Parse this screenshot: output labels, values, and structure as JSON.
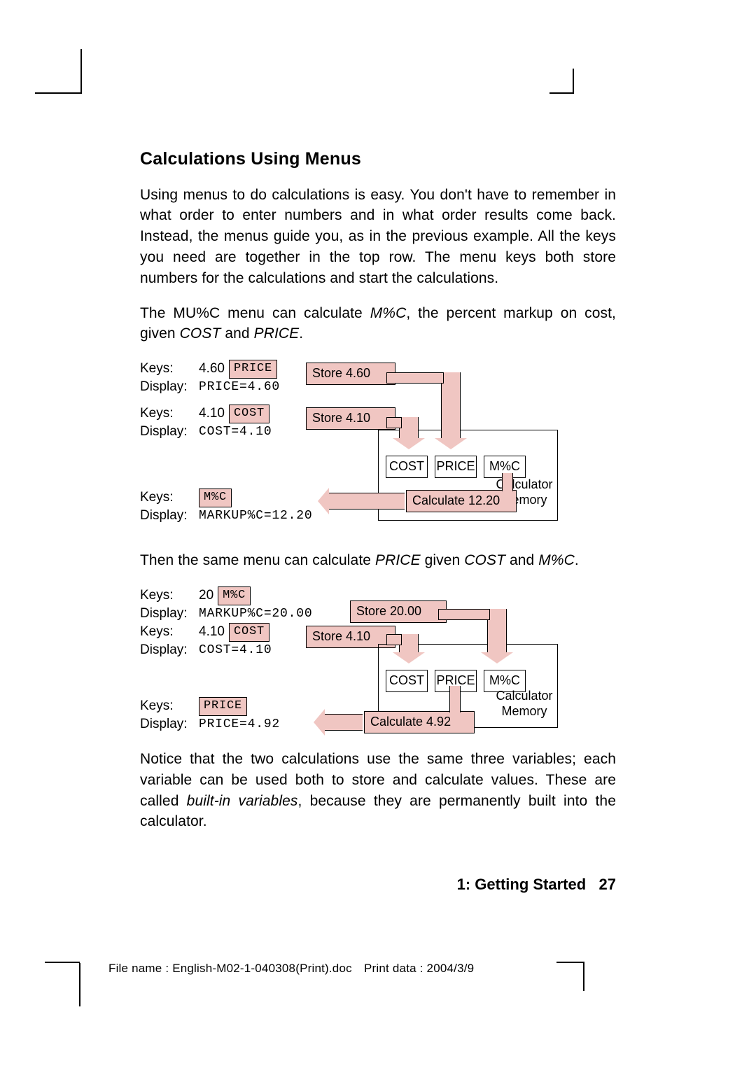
{
  "h2": "Calculations Using Menus",
  "p1": "Using menus to do calculations is easy. You don't have to remember in what order to enter numbers and in what order results come back. Instead, the menus guide you, as in the previous example. All the keys you need are together in the top row. The menu keys both store numbers for the calculations and start the calculations.",
  "p2_a": "The MU%C menu can calculate ",
  "p2_b": "M%C",
  "p2_c": ", the percent markup on cost, given ",
  "p2_d": "COST",
  "p2_e": " and ",
  "p2_f": "PRICE",
  "p2_g": ".",
  "d1": {
    "r1_keys": "Keys:",
    "r1_val": "4.60",
    "r1_box": "PRICE",
    "r1_disp_l": "Display:",
    "r1_disp_v": "PRICE=4.60",
    "r1_store": "Store 4.60",
    "r2_keys": "Keys:",
    "r2_val": "4.10",
    "r2_box": "COST",
    "r2_disp_l": "Display:",
    "r2_disp_v": "COST=4.10",
    "r2_store": "Store 4.10",
    "menu1": "COST",
    "menu2": "PRICE",
    "menu3": "M%C",
    "memlabel": "Calculator\nMemory",
    "r3_keys": "Keys:",
    "r3_box": "M%C",
    "r3_disp_l": "Display:",
    "r3_disp_v": "MARKUP%C=12.20",
    "r3_calc": "Calculate 12.20"
  },
  "p3_a": "Then the same menu can calculate ",
  "p3_b": "PRICE",
  "p3_c": " given ",
  "p3_d": "COST",
  "p3_e": " and ",
  "p3_f": "M%C",
  "p3_g": ".",
  "d2": {
    "r1_keys": "Keys:",
    "r1_val": "20",
    "r1_box": "M%C",
    "r1_disp_l": "Display:",
    "r1_disp_v": "MARKUP%C=20.00",
    "r1_store": "Store 20.00",
    "r2_keys": "Keys:",
    "r2_val": "4.10",
    "r2_box": "COST",
    "r2_disp_l": "Display:",
    "r2_disp_v": "COST=4.10",
    "r2_store": "Store 4.10",
    "menu1": "COST",
    "menu2": "PRICE",
    "menu3": "M%C",
    "memlabel": "Calculator\nMemory",
    "r3_keys": "Keys:",
    "r3_box": "PRICE",
    "r3_disp_l": "Display:",
    "r3_disp_v": "PRICE=4.92",
    "r3_calc": "Calculate 4.92"
  },
  "p4_a": "Notice that the two calculations use the same three variables; each variable can be used both to store and calculate values.  These are called ",
  "p4_b": "built-in variables",
  "p4_c": ", because they are permanently built into the calculator.",
  "footer_chapter": "1: Getting Started",
  "footer_page": "27",
  "fileinfo": "File name : English-M02-1-040308(Print).doc Print data : 2004/3/9"
}
